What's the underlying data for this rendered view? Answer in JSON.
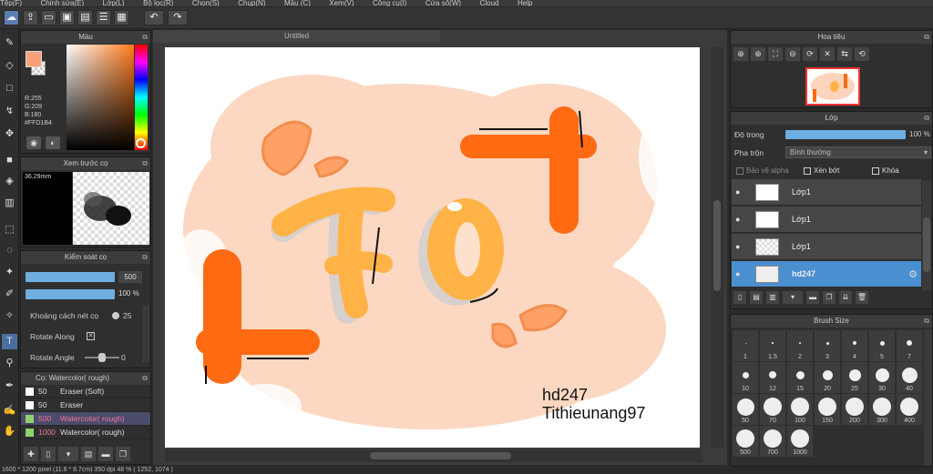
{
  "menu": [
    "Tệp(F)",
    "Chỉnh sửa(E)",
    "Lớp(L)",
    "Bộ lọc(R)",
    "Chọn(S)",
    "Chụp(N)",
    "Mẫu (C)",
    "Xem(V)",
    "Công cụ(I)",
    "Cửa sổ(W)",
    "Cloud",
    "Help"
  ],
  "document": {
    "tab_title": "Untitled"
  },
  "color_panel": {
    "title": "Màu",
    "r": "R:255",
    "g": "G:209",
    "b": "B:180",
    "hex": "#FFD1B4",
    "primary": "#f7a07a",
    "secondary": "#ffffff"
  },
  "preview_panel": {
    "title": "Xem trước cọ",
    "size": "36.29mm"
  },
  "brush_control": {
    "title": "Kiểm soát cọ",
    "size_value": "500",
    "opacity_value": "100 %",
    "spacing_label": "Khoảng cách nét cọ",
    "spacing_value": "25",
    "rotate_along_label": "Rotate Along",
    "rotate_angle_label": "Rotate Angle",
    "rotate_angle_value": "0"
  },
  "brush_list": {
    "title": "Cọ: Watercolor( rough)",
    "items": [
      {
        "size": "50",
        "name": "Eraser (Soft)"
      },
      {
        "size": "50",
        "name": "Eraser"
      },
      {
        "size": "500",
        "name": "Watercolor( rough)"
      },
      {
        "size": "1000",
        "name": "Watercolor( rough)"
      }
    ]
  },
  "navigator": {
    "title": "Hoa tiêu"
  },
  "layers_panel": {
    "title": "Lớp",
    "opacity_label": "Độ trong",
    "opacity_value": "100 %",
    "blend_label": "Pha trộn",
    "blend_value": "Bình thường",
    "protect_alpha": "Bảo vệ alpha",
    "clip": "Xén bớt",
    "lock": "Khóa",
    "layers": [
      {
        "name": "Lớp1"
      },
      {
        "name": "Lớp1"
      },
      {
        "name": "Lớp1"
      },
      {
        "name": "hd247"
      }
    ]
  },
  "brush_size": {
    "title": "Brush Size",
    "sizes": [
      "1",
      "1.5",
      "2",
      "3",
      "4",
      "5",
      "7",
      "10",
      "12",
      "15",
      "20",
      "25",
      "30",
      "40",
      "50",
      "70",
      "100",
      "150",
      "200",
      "300",
      "400",
      "500",
      "700",
      "1000"
    ]
  },
  "artwork": {
    "letters": "FO",
    "credit1": "hd247",
    "credit2": "Tithieunang97"
  },
  "status": "1600 * 1200 pixel   (11.6 * 8.7cm)  350 dpi   48 %   ( 1252, 1074 )"
}
